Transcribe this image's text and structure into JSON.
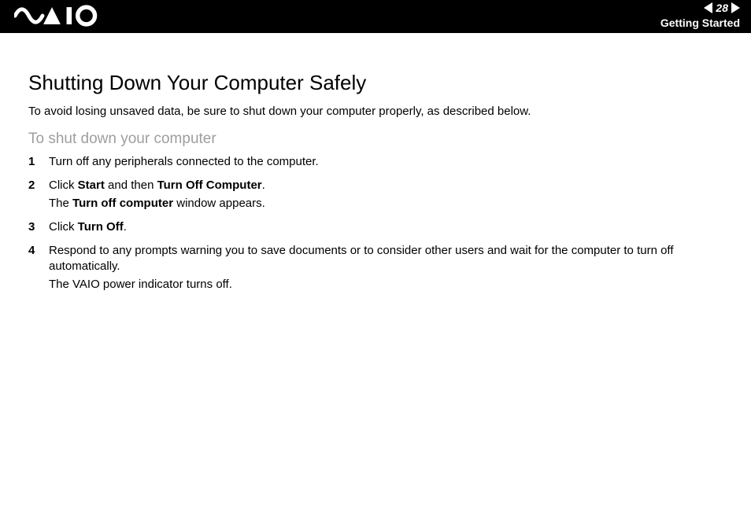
{
  "header": {
    "page_number": "28",
    "section": "Getting Started",
    "logo_alt": "VAIO"
  },
  "title": "Shutting Down Your Computer Safely",
  "intro": "To avoid losing unsaved data, be sure to shut down your computer properly, as described below.",
  "subtitle": "To shut down your computer",
  "steps": [
    {
      "n": "1",
      "parts": [
        {
          "t": "Turn off any peripherals connected to the computer."
        }
      ]
    },
    {
      "n": "2",
      "parts": [
        {
          "t": "Click "
        },
        {
          "b": "Start"
        },
        {
          "t": " and then "
        },
        {
          "b": "Turn Off Computer"
        },
        {
          "t": "."
        }
      ],
      "parts2": [
        {
          "t": "The "
        },
        {
          "b": "Turn off computer"
        },
        {
          "t": " window appears."
        }
      ]
    },
    {
      "n": "3",
      "parts": [
        {
          "t": "Click "
        },
        {
          "b": "Turn Off"
        },
        {
          "t": "."
        }
      ]
    },
    {
      "n": "4",
      "parts": [
        {
          "t": "Respond to any prompts warning you to save documents or to consider other users and wait for the computer to turn off automatically."
        }
      ],
      "extra": "The VAIO power indicator turns off."
    }
  ]
}
